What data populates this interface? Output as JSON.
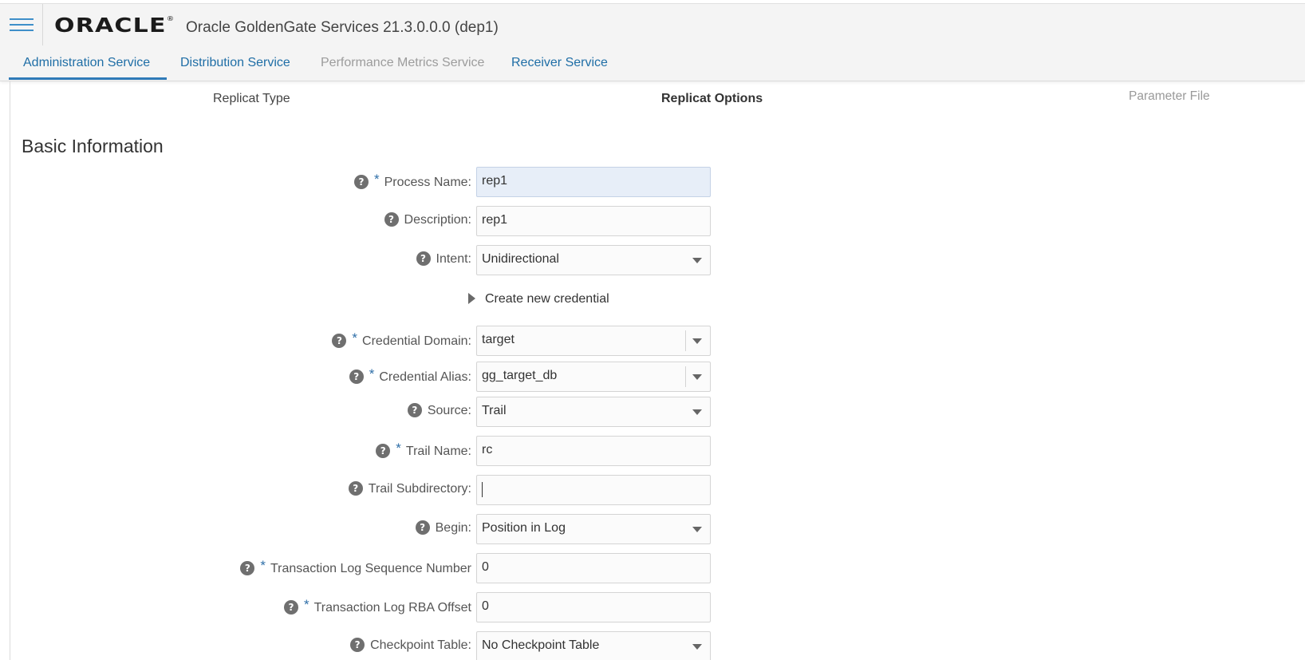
{
  "header": {
    "logo_text": "ORACLE",
    "logo_mark": "®",
    "app_title": "Oracle GoldenGate Services 21.3.0.0.0 (dep1)",
    "menu_icon": "hamburger-menu-icon"
  },
  "tabs": [
    {
      "label": "Administration Service",
      "state": "active"
    },
    {
      "label": "Distribution Service",
      "state": "enabled"
    },
    {
      "label": "Performance Metrics Service",
      "state": "disabled"
    },
    {
      "label": "Receiver Service",
      "state": "enabled"
    }
  ],
  "wizard": {
    "steps": [
      "Replicat Type",
      "Replicat Options",
      "Parameter File"
    ],
    "current_step": "Replicat Options"
  },
  "section": {
    "title": "Basic Information"
  },
  "form": {
    "process_name": {
      "label": "Process Name:",
      "value": "rep1",
      "required": true
    },
    "description": {
      "label": "Description:",
      "value": "rep1",
      "required": false
    },
    "intent": {
      "label": "Intent:",
      "value": "Unidirectional",
      "required": false
    },
    "create_credential": {
      "label": "Create new credential"
    },
    "credential_domain": {
      "label": "Credential Domain:",
      "value": "target",
      "required": true
    },
    "credential_alias": {
      "label": "Credential Alias:",
      "value": "gg_target_db",
      "required": true
    },
    "source": {
      "label": "Source:",
      "value": "Trail",
      "required": false
    },
    "trail_name": {
      "label": "Trail Name:",
      "value": "rc",
      "required": true
    },
    "trail_subdirectory": {
      "label": "Trail Subdirectory:",
      "value": "",
      "required": false
    },
    "begin": {
      "label": "Begin:",
      "value": "Position in Log",
      "required": false
    },
    "log_sequence": {
      "label": "Transaction Log Sequence Number",
      "value": "0",
      "required": true
    },
    "rba_offset": {
      "label": "Transaction Log RBA Offset",
      "value": "0",
      "required": true
    },
    "checkpoint_table": {
      "label": "Checkpoint Table:",
      "value": "No Checkpoint Table",
      "required": false
    }
  },
  "symbols": {
    "help": "?",
    "required": "*"
  },
  "colors": {
    "accent": "#1f6ea6",
    "help_icon": "#6f6f6f",
    "focus_field": "#e7eef8"
  }
}
